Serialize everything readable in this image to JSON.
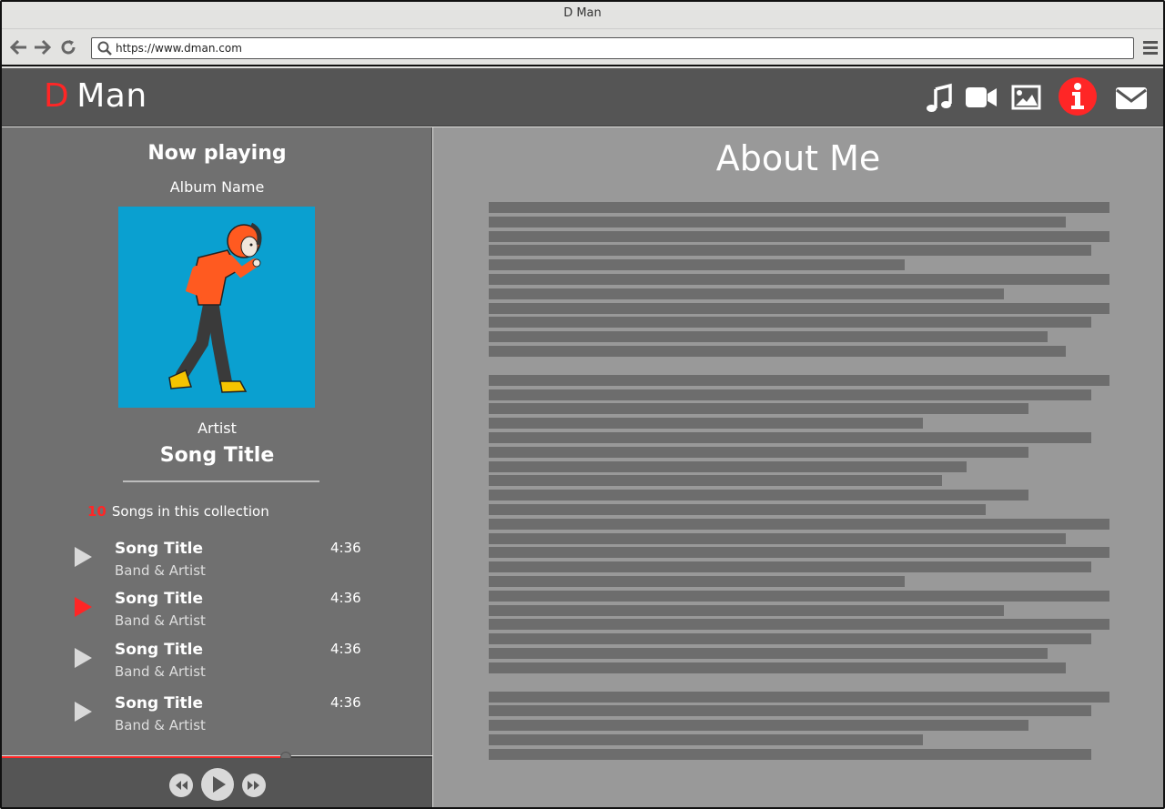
{
  "browser": {
    "title": "D Man",
    "url": "https://www.dman.com"
  },
  "header": {
    "logo_d": "D",
    "logo_rest": "Man",
    "nav_icons": [
      "music-icon",
      "video-icon",
      "image-icon",
      "info-icon",
      "mail-icon"
    ],
    "active_icon": "info-icon"
  },
  "player": {
    "heading": "Now playing",
    "album": "Album Name",
    "artist": "Artist",
    "song": "Song Title",
    "collection_count": "10",
    "collection_label": "Songs in this collection",
    "tracks": [
      {
        "title": "Song Title",
        "artist": "Band & Artist",
        "duration": "4:36",
        "active": false
      },
      {
        "title": "Song Title",
        "artist": "Band & Artist",
        "duration": "4:36",
        "active": true
      },
      {
        "title": "Song Title",
        "artist": "Band & Artist",
        "duration": "4:36",
        "active": false
      },
      {
        "title": "Song Title",
        "artist": "Band & Artist",
        "duration": "4:36",
        "active": false
      }
    ],
    "progress_fraction": 0.66
  },
  "about": {
    "title": "About Me"
  },
  "colors": {
    "accent": "#ff2626",
    "header_bg": "#555555",
    "panel_bg": "#707070",
    "content_bg": "#999999",
    "album_bg": "#0aa0d0"
  }
}
